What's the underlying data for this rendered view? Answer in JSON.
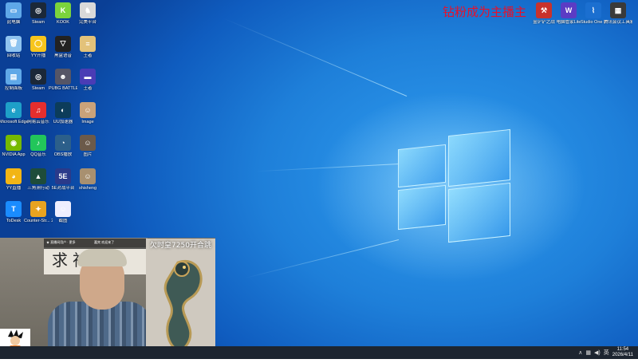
{
  "banner": {
    "text": "钻粉成为主播主"
  },
  "desktop_left": [
    [
      {
        "label": "此电脑",
        "icon": "pc-icon",
        "color": "#5fa8e8",
        "glyph": "▭"
      },
      {
        "label": "Steam",
        "icon": "steam-icon",
        "color": "#1b2838",
        "glyph": "◎"
      },
      {
        "label": "KOOK",
        "icon": "kook-icon",
        "color": "#7bd33c",
        "glyph": "K"
      },
      {
        "label": "完美平台",
        "icon": "perfect-icon",
        "color": "#d9d9d9",
        "glyph": "♞"
      }
    ],
    [
      {
        "label": "回收站",
        "icon": "recycle-bin-icon",
        "color": "#8fc3ef",
        "glyph": "🗑"
      },
      {
        "label": "YY开播",
        "icon": "yy-icon",
        "color": "#f7c51c",
        "glyph": "◯"
      },
      {
        "label": "黑盒语音",
        "icon": "heybox-icon",
        "color": "#222",
        "glyph": "▽"
      },
      {
        "label": "王者",
        "icon": "burger-icon",
        "color": "#e3c27a",
        "glyph": "≡"
      }
    ],
    [
      {
        "label": "控制面板",
        "icon": "control-panel-icon",
        "color": "#5fa8e8",
        "glyph": "▤"
      },
      {
        "label": "Steam",
        "icon": "steam-icon",
        "color": "#1b2838",
        "glyph": "◎"
      },
      {
        "label": "PUBG BATTLEG...",
        "icon": "pubg-icon",
        "color": "#556",
        "glyph": "☻"
      },
      {
        "label": "王者",
        "icon": "wangzhe-icon",
        "color": "#4a3cb5",
        "glyph": "▬"
      }
    ],
    [
      {
        "label": "Microsoft Edge",
        "icon": "edge-icon",
        "color": "#1ea0c8",
        "glyph": "e"
      },
      {
        "label": "网易云音乐",
        "icon": "netease-music-icon",
        "color": "#e62e2e",
        "glyph": "♫"
      },
      {
        "label": "UU加速器",
        "icon": "uu-icon",
        "color": "#0c3c5a",
        "glyph": "◐"
      },
      {
        "label": "Image",
        "icon": "photo-icon",
        "color": "#c9a27a",
        "glyph": "☺"
      }
    ],
    [
      {
        "label": "NVIDIA App",
        "icon": "nvidia-icon",
        "color": "#76b900",
        "glyph": "◉"
      },
      {
        "label": "QQ音乐",
        "icon": "qq-music-icon",
        "color": "#22c65a",
        "glyph": "♪"
      },
      {
        "label": "OBS播放",
        "icon": "obs-icon",
        "color": "#2c5f8a",
        "glyph": "◔"
      },
      {
        "label": "图片",
        "icon": "photo2-icon",
        "color": "#6b5a4a",
        "glyph": "☺"
      }
    ],
    [
      {
        "label": "YY直播",
        "icon": "yy-live-icon",
        "color": "#f2b515",
        "glyph": "◕"
      },
      {
        "label": "三角洲行动",
        "icon": "delta-icon",
        "color": "#1e4c3a",
        "glyph": "▲"
      },
      {
        "label": "5E对战平台",
        "icon": "5e-icon",
        "color": "#2a3a8a",
        "glyph": "5E"
      },
      {
        "label": "shisheng",
        "icon": "photo3-icon",
        "color": "#a89070",
        "glyph": "☺"
      }
    ],
    [
      {
        "label": "ToDesk",
        "icon": "todesk-icon",
        "color": "#1a8cff",
        "glyph": "T"
      },
      {
        "label": "Counter-Str... 2",
        "icon": "cs2-icon",
        "color": "#e8a320",
        "glyph": "✦"
      },
      {
        "label": "截图",
        "icon": "goku-icon",
        "color": "#eef",
        "glyph": "☺"
      },
      null
    ]
  ],
  "desktop_right": [
    {
      "label": "金铲铲之战",
      "icon": "gold-shovel-icon",
      "color": "#c8322c",
      "glyph": "⚒"
    },
    {
      "label": "电脑管家Lite",
      "icon": "pc-manager-icon",
      "color": "#5b3cc4",
      "glyph": "W"
    },
    {
      "label": "Studio One 7",
      "icon": "studio-one-icon",
      "color": "#1b6fd0",
      "glyph": "⌇"
    },
    {
      "label": "腾讯会议工具箱",
      "icon": "toolbox-icon",
      "color": "#3a3a3a",
      "glyph": "▦"
    }
  ],
  "stream": {
    "calligraphy": "求神",
    "topbar": [
      "★ 直播间用户 · 更多",
      "嘉宾 欢迎来了"
    ],
    "overlay_text": "欠时皇7250开合跳"
  },
  "taskbar": {
    "tray_icons": [
      {
        "icon": "network-icon",
        "glyph": "▦"
      },
      {
        "icon": "volume-icon",
        "glyph": "◀)"
      },
      {
        "icon": "chevron-up-icon",
        "glyph": "∧"
      }
    ],
    "ime": "英",
    "time": "11:54",
    "date": "2026/4/11"
  },
  "colors": {
    "banner_red": "#e8102a",
    "taskbar": "#1d2530"
  }
}
